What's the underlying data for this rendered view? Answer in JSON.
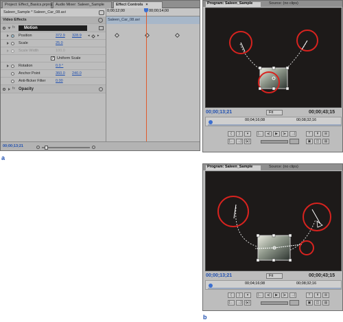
{
  "panel_a": {
    "tabs": [
      "Project: Effect_Basics.prproj",
      "Audio Mixer: Saleen_Sample",
      "Effect Controls"
    ],
    "tab_close_glyph": "×",
    "clip_path": "Saleen_Sample * Saleen_Car_08.avi",
    "ruler_start": "0;00;12;00",
    "ruler_end": "00;00;14;00",
    "timeline_clip": "Saleen_Car_08.avi",
    "section_title": "Video Effects",
    "motion_label": "Motion",
    "fx_badge": "fx",
    "properties": {
      "position": {
        "label": "Position",
        "x": "372.9",
        "y": "328.9"
      },
      "scale": {
        "label": "Scale",
        "value": "25.0"
      },
      "scale_width": {
        "label": "Scale Width",
        "value": "100.0"
      },
      "uniform_scale": {
        "label": "Uniform Scale",
        "checked": true
      },
      "rotation": {
        "label": "Rotation",
        "value": "0.0 °"
      },
      "anchor": {
        "label": "Anchor Point",
        "x": "360.0",
        "y": "240.0"
      },
      "antiflicker": {
        "label": "Anti-flicker Filter",
        "value": "0.00"
      }
    },
    "opacity_label": "Opacity",
    "footer_timecode": "00;00;13;21"
  },
  "monitor_a": {
    "tabs": [
      "Program: Saleen_Sample",
      "Source: (no clips)"
    ],
    "timecode_left": "00;00;13;21",
    "fit": "Fit",
    "timecode_right": "00;00;43;15",
    "ruler_left": "00;04;16;08",
    "ruler_right": "00;08;32;16"
  },
  "monitor_b": {
    "tabs": [
      "Program: Saleen_Sample",
      "Source: (no clips)"
    ],
    "timecode_left": "00;00;13;21",
    "fit": "Fit",
    "timecode_right": "00;00;43;15",
    "ruler_left": "00;04;16;08",
    "ruler_right": "00;08;32;16"
  },
  "captions": {
    "a": "a",
    "b": "b"
  },
  "colors": {
    "timecode": "#1f4fb0",
    "circle": "#d8231f",
    "playhead": "#e05a2a"
  }
}
